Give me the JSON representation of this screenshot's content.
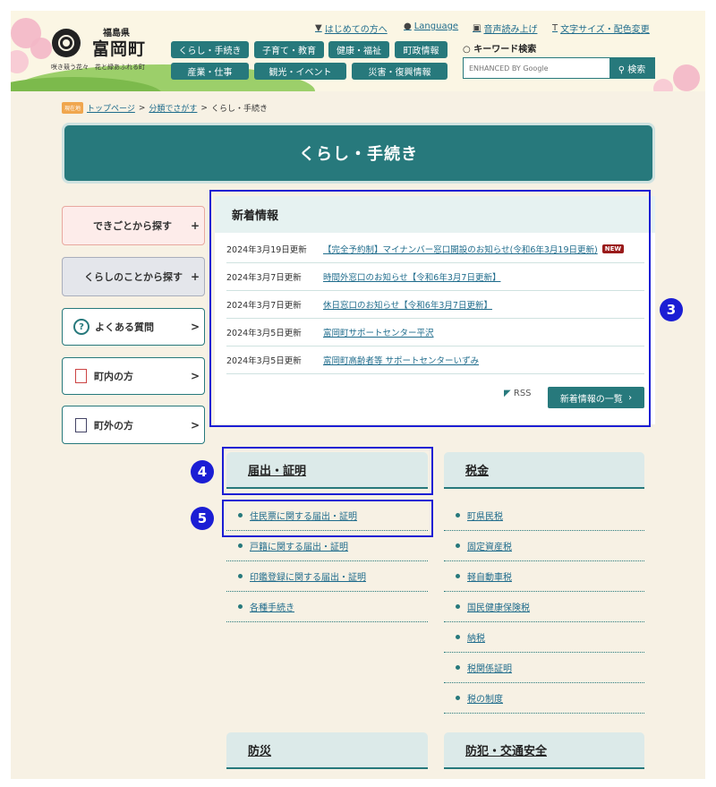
{
  "header": {
    "prefecture": "福島県",
    "town": "富岡町",
    "tagline": "咲き競う花々　花と緑あふれる町",
    "utility_links": [
      "はじめての方へ",
      "Language",
      "音声読み上げ",
      "文字サイズ・配色変更"
    ],
    "nav_row1": [
      "くらし・手続き",
      "子育て・教育",
      "健康・福祉",
      "町政情報"
    ],
    "nav_row2": [
      "産業・仕事",
      "観光・イベント",
      "災害・復興情報"
    ],
    "keyword_label": "キーワード検索",
    "search_placeholder": "ENHANCED BY Google",
    "search_button": "検索"
  },
  "breadcrumb": {
    "tag": "現在地",
    "items": [
      "トップページ",
      "分類でさがす",
      "くらし・手続き"
    ],
    "sep": ">"
  },
  "page_title": "くらし・手続き",
  "sidebar": [
    {
      "label": "できごとから探す",
      "arrow": "+"
    },
    {
      "label": "くらしのことから探す",
      "arrow": "+"
    },
    {
      "label": "よくある質問",
      "arrow": ">"
    },
    {
      "label": "町内の方",
      "arrow": ">"
    },
    {
      "label": "町外の方",
      "arrow": ">"
    }
  ],
  "news": {
    "heading": "新着情報",
    "items": [
      {
        "date": "2024年3月19日更新",
        "title": "【完全予約制】マイナンバー窓口開設のお知らせ(令和6年3月19日更新)",
        "badge": "NEW"
      },
      {
        "date": "2024年3月7日更新",
        "title": "時間外窓口のお知らせ【令和6年3月7日更新】",
        "badge": ""
      },
      {
        "date": "2024年3月7日更新",
        "title": "休日窓口のお知らせ【令和6年3月7日更新】",
        "badge": ""
      },
      {
        "date": "2024年3月5日更新",
        "title": "富岡町サポートセンター平沢",
        "badge": ""
      },
      {
        "date": "2024年3月5日更新",
        "title": "富岡町高齢者等 サポートセンターいずみ",
        "badge": ""
      }
    ],
    "rss": "RSS",
    "more": "新着情報の一覧"
  },
  "categories": {
    "left": {
      "heading": "届出・証明",
      "items": [
        "住民票に関する届出・証明",
        "戸籍に関する届出・証明",
        "印鑑登録に関する届出・証明",
        "各種手続き"
      ]
    },
    "right": {
      "heading": "税金",
      "items": [
        "町県民税",
        "固定資産税",
        "軽自動車税",
        "国民健康保険税",
        "納税",
        "税関係証明",
        "税の制度"
      ]
    },
    "bottom_left": "防災",
    "bottom_right": "防犯・交通安全"
  },
  "markers": [
    "3",
    "4",
    "5"
  ],
  "colors": {
    "primary": "#27797c",
    "highlight": "#1b1ed4",
    "link": "#1f6c8c"
  }
}
